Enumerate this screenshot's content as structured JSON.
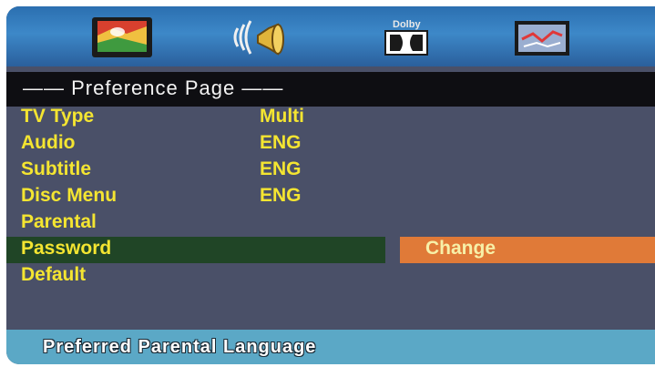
{
  "header": {
    "tabs": [
      {
        "icon": "tv-picture-icon"
      },
      {
        "icon": "speaker-audio-icon"
      },
      {
        "icon": "dolby-icon",
        "label": "Dolby"
      },
      {
        "icon": "preference-settings-icon"
      }
    ]
  },
  "page_title": "—— Preference Page ——",
  "menu": [
    {
      "label": "TV Type",
      "value": "Multi"
    },
    {
      "label": "Audio",
      "value": "ENG"
    },
    {
      "label": "Subtitle",
      "value": "ENG"
    },
    {
      "label": "Disc Menu",
      "value": "ENG"
    },
    {
      "label": "Parental",
      "value": ""
    },
    {
      "label": "Password",
      "value": "",
      "selected": true
    },
    {
      "label": "Default",
      "value": ""
    }
  ],
  "submenu": {
    "option": "Change"
  },
  "status": "Preferred Parental Language",
  "colors": {
    "background": "#4a5068",
    "text": "#f4e531",
    "title_bar": "#0e0e12",
    "selected_row": "#204526",
    "submenu_highlight": "#e07a38",
    "status_bar": "#5ba8c6"
  }
}
